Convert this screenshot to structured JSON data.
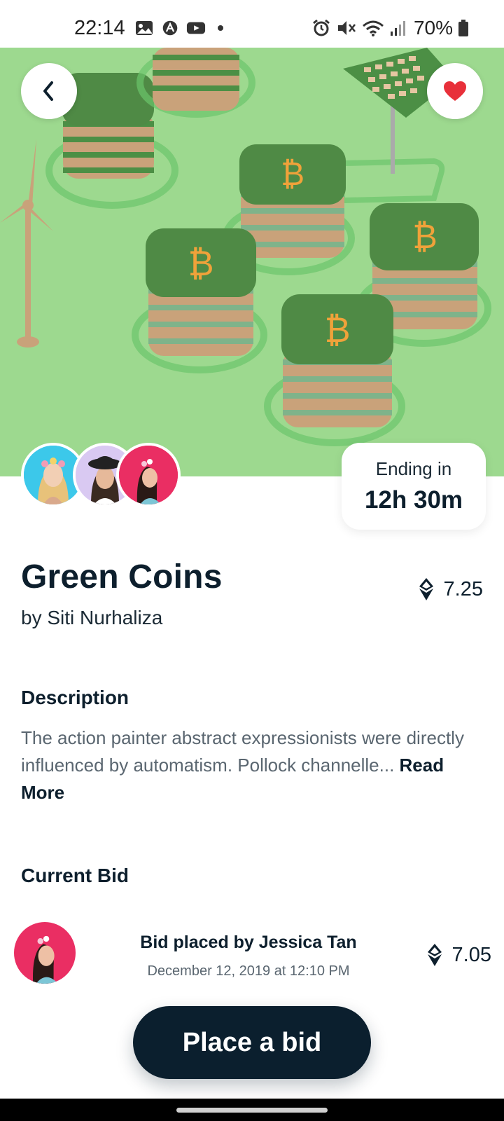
{
  "status_bar": {
    "time": "22:14",
    "battery": "70%",
    "icons_left": [
      "gallery-icon",
      "app-icon",
      "youtube-icon",
      "notification-dot"
    ],
    "icons_right": [
      "alarm-icon",
      "mute-icon",
      "wifi-icon",
      "signal-icon",
      "battery-icon"
    ]
  },
  "hero": {
    "background_color": "#9dd98f",
    "back_icon": "chevron-left-icon",
    "like_icon": "heart-icon"
  },
  "bidders": {
    "avatars": [
      "avatar-1",
      "avatar-2",
      "avatar-3"
    ]
  },
  "ending": {
    "label": "Ending in",
    "value": "12h 30m"
  },
  "item": {
    "title": "Green Coins",
    "author": "by Siti Nurhaliza",
    "price": "7.25",
    "currency_icon": "ethereum-icon"
  },
  "description": {
    "heading": "Description",
    "text": "The action painter abstract expressionists were directly influenced by automatism. Pollock channelle...",
    "read_more": "Read More"
  },
  "current_bid": {
    "heading": "Current Bid",
    "bidder_line": "Bid placed by Jessica Tan",
    "date": "December 12, 2019 at 12:10 PM",
    "price": "7.05"
  },
  "actions": {
    "place_bid": "Place a bid"
  },
  "colors": {
    "primary_dark": "#0b1f2e",
    "hero_green": "#9dd98f",
    "accent_heart": "#e8303a",
    "coin_orange": "#f0a23a"
  }
}
